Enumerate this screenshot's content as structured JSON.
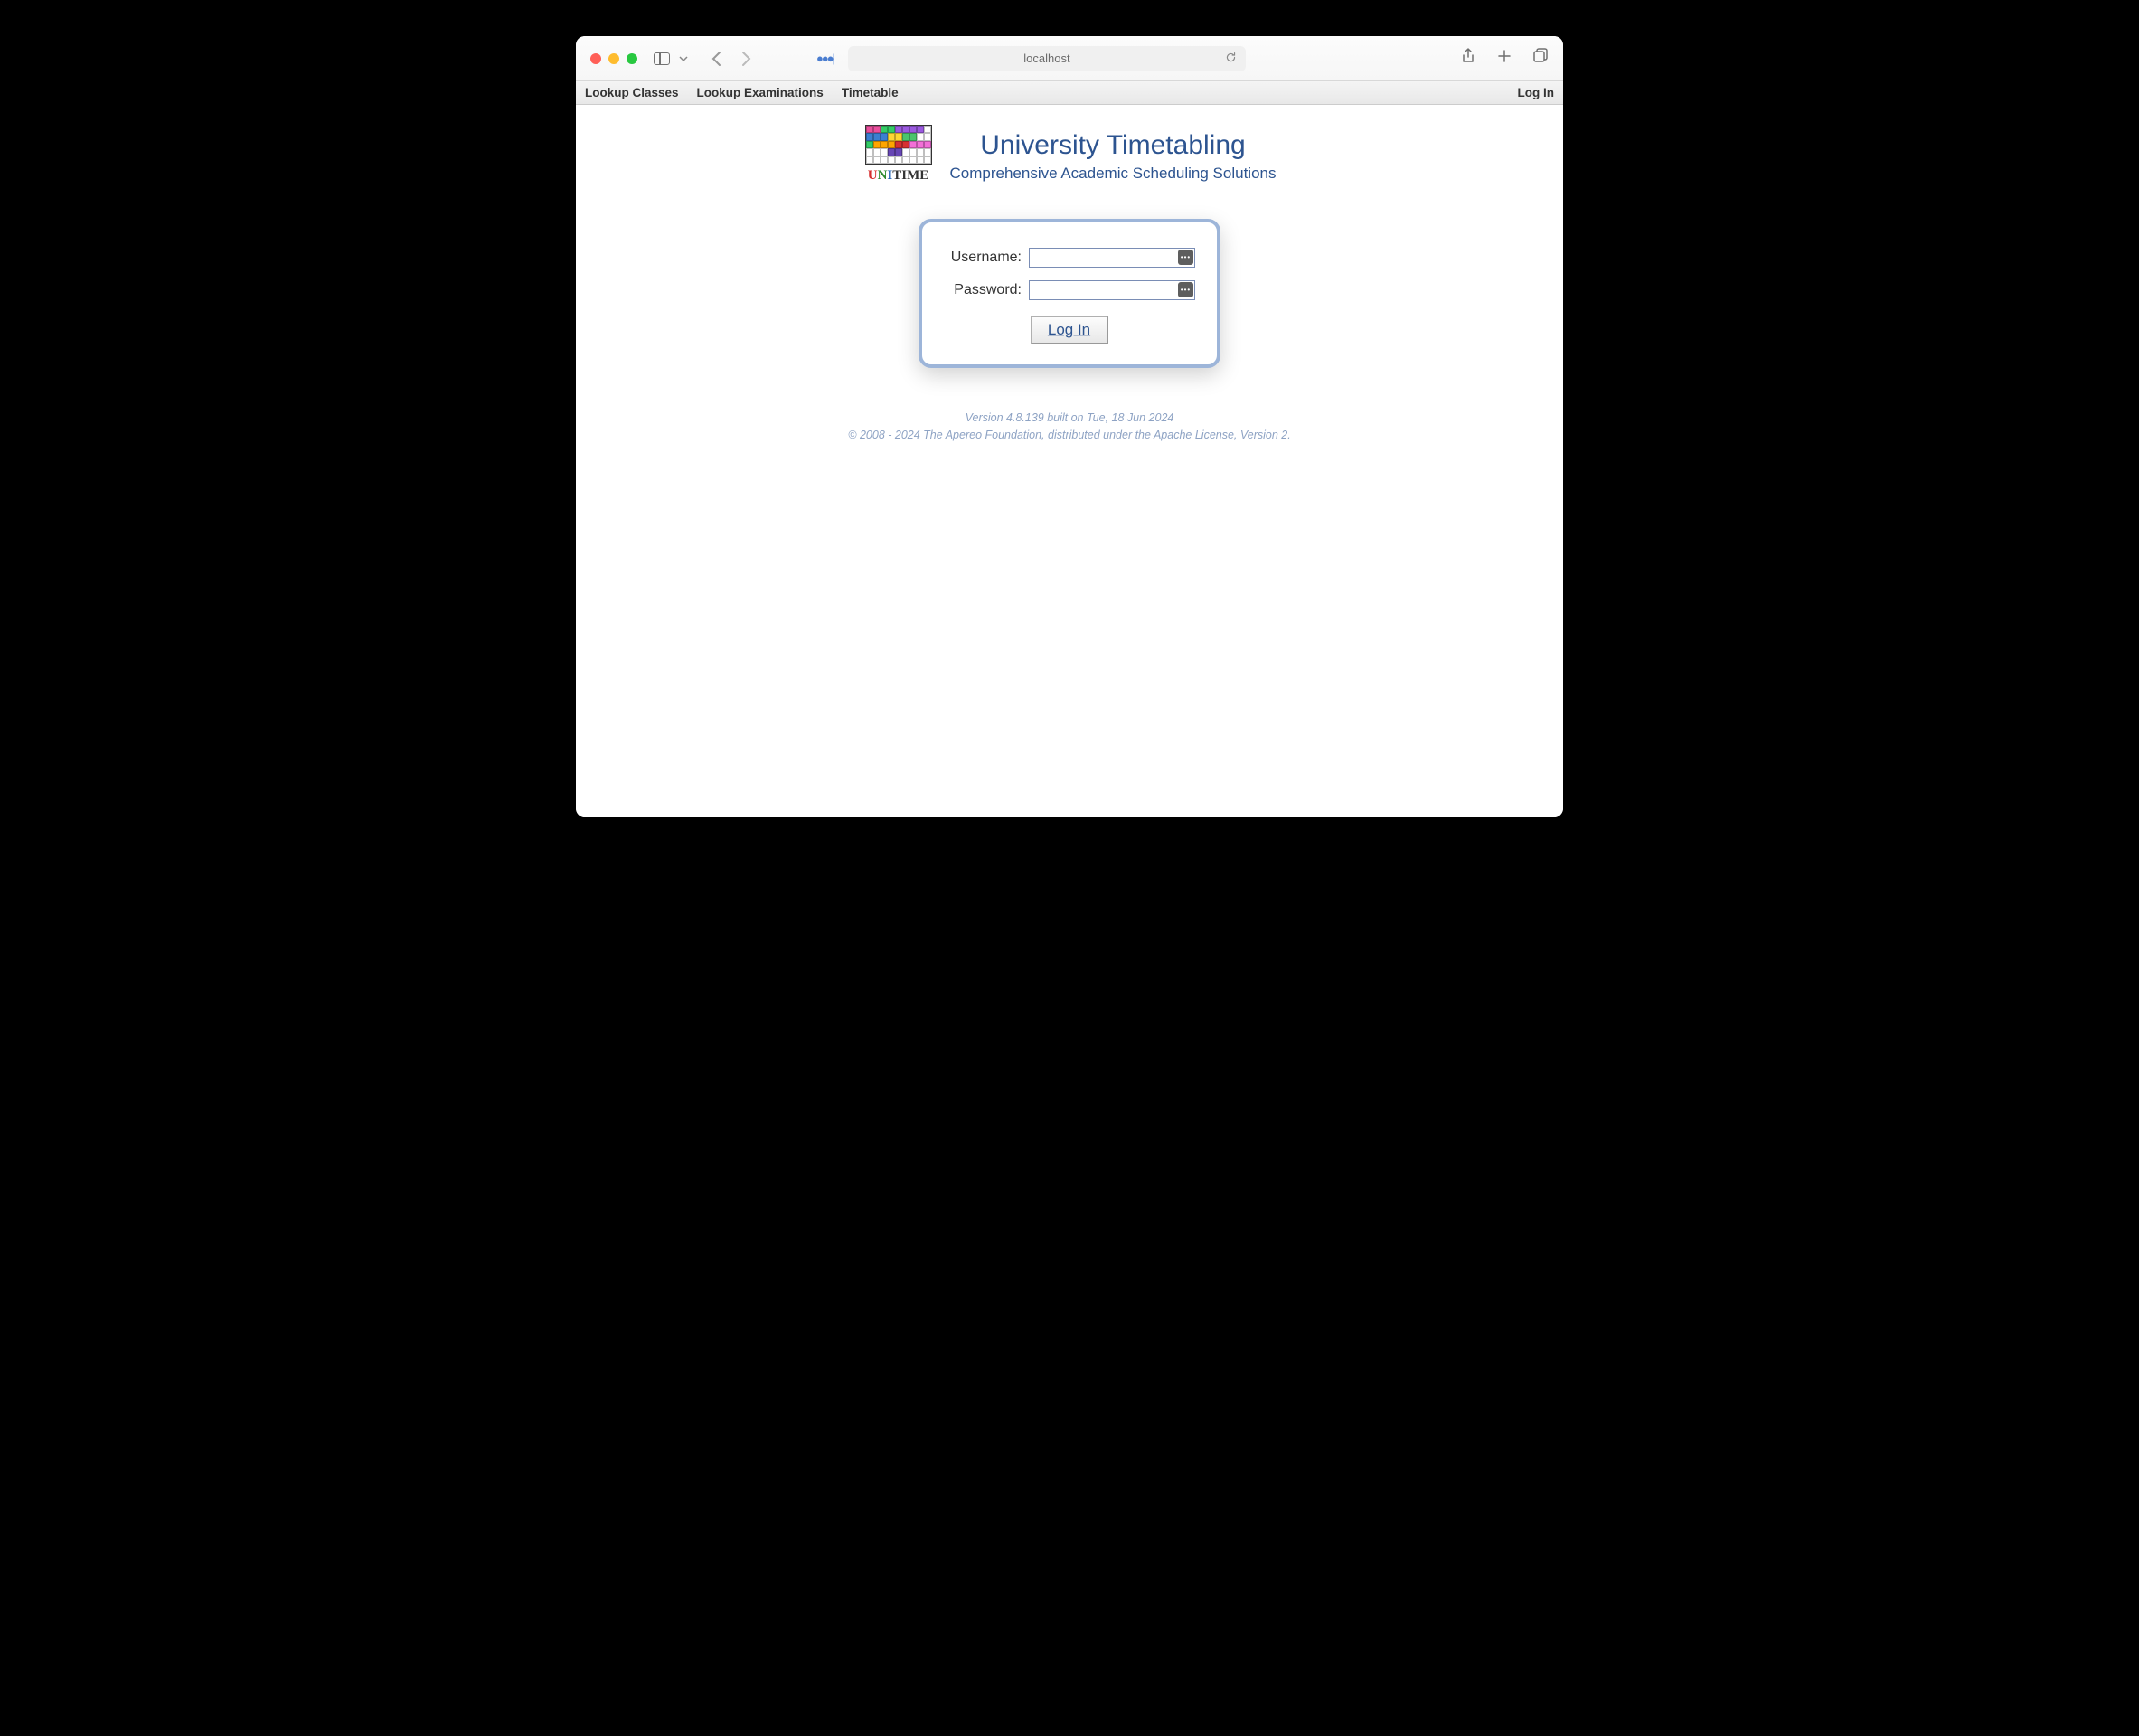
{
  "browser": {
    "url": "localhost"
  },
  "nav": {
    "items": [
      "Lookup Classes",
      "Lookup Examinations",
      "Timetable"
    ],
    "right": "Log In"
  },
  "header": {
    "title": "University Timetabling",
    "subtitle": "Comprehensive Academic Scheduling Solutions",
    "logo_text": "UniTime"
  },
  "login": {
    "username_label": "Username:",
    "password_label": "Password:",
    "button": "Log In"
  },
  "footer": {
    "version": "Version 4.8.139 built on Tue, 18 Jun 2024",
    "copyright": "© 2008 - 2024 The Apereo Foundation, distributed under the Apache License, Version 2."
  },
  "logo_colors": [
    "#e94f9c",
    "#e94f9c",
    "#33cc66",
    "#33cc66",
    "#9b5adf",
    "#9b5adf",
    "#9b5adf",
    "#9b5adf",
    "#ffffff",
    "#3b7fd0",
    "#3b7fd0",
    "#3b7fd0",
    "#ffd633",
    "#ffd633",
    "#4ac46d",
    "#4ac46d",
    "#ffffff",
    "#ffffff",
    "#33cc66",
    "#ffa500",
    "#ffa500",
    "#ffa500",
    "#d63031",
    "#d63031",
    "#f26fd7",
    "#f26fd7",
    "#f26fd7",
    "#ffffff",
    "#ffffff",
    "#ffffff",
    "#6746b5",
    "#6746b5",
    "#ffffff",
    "#ffffff",
    "#ffffff",
    "#ffffff",
    "#ffffff",
    "#ffffff",
    "#ffffff",
    "#ffffff",
    "#ffffff",
    "#ffffff",
    "#ffffff",
    "#ffffff",
    "#ffffff"
  ]
}
